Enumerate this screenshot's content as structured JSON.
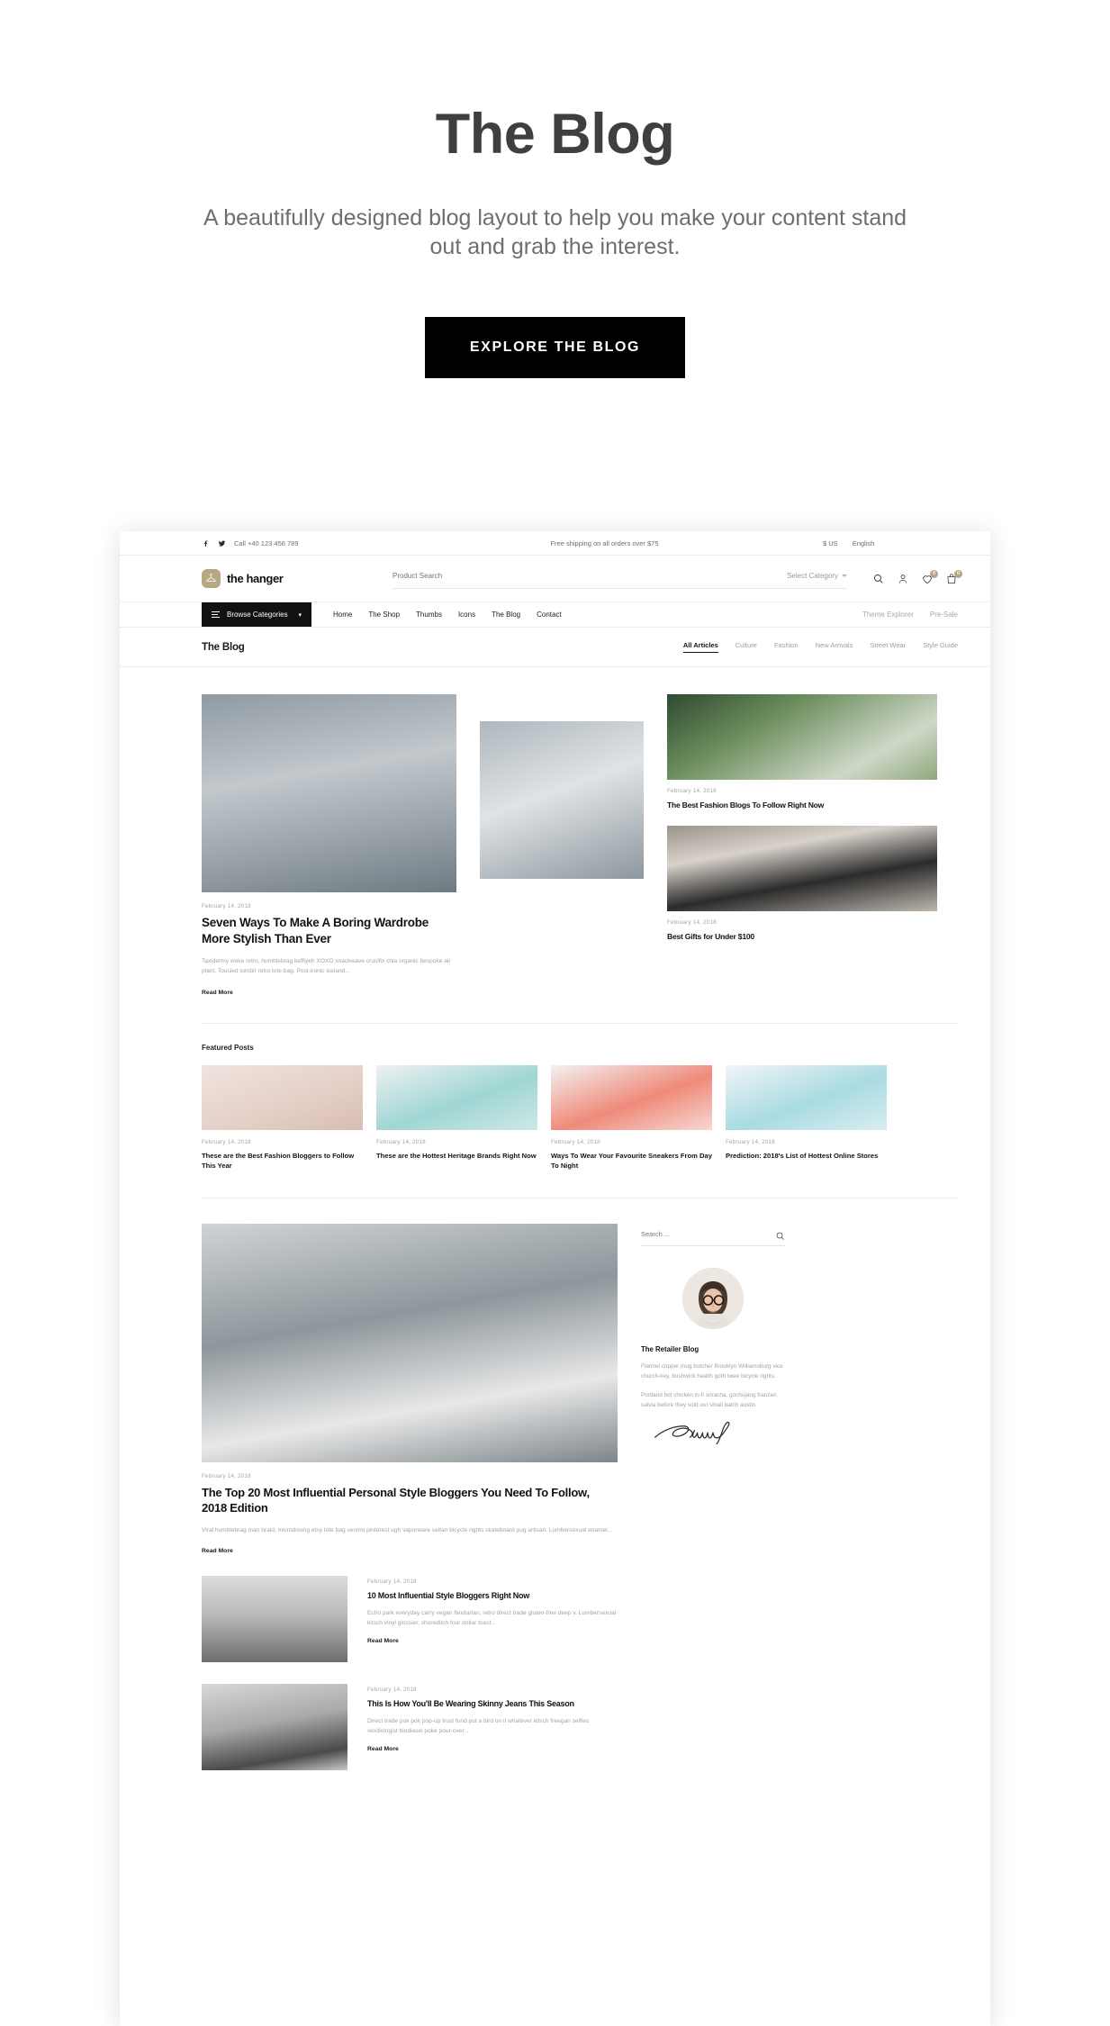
{
  "hero": {
    "title": "The Blog",
    "subtitle": "A beautifully designed blog layout to help you make your content stand out and grab the interest.",
    "cta_label": "EXPLORE THE BLOG"
  },
  "topbar": {
    "phone": "Call +40 123 456 789",
    "shipping": "Free shipping on all orders over $75",
    "currency": "$ US",
    "language": "English",
    "social": [
      "facebook-icon",
      "twitter-icon"
    ]
  },
  "header": {
    "logo_text": "the hanger",
    "logo_icon": "hanger-icon",
    "search_placeholder": "Product Search",
    "search_value": "",
    "category_label": "Select Category",
    "icons": [
      {
        "name": "account-icon",
        "badge": ""
      },
      {
        "name": "wishlist-heart-icon",
        "badge": "0"
      },
      {
        "name": "cart-bag-icon",
        "badge": "0"
      }
    ]
  },
  "nav": {
    "browse_label": "Browse Categories",
    "links": [
      "Home",
      "The Shop",
      "Thumbs",
      "Icons",
      "The Blog",
      "Contact"
    ],
    "right_links": [
      "Theme Explorer",
      "Pre-Sale"
    ]
  },
  "blogbar": {
    "title": "The Blog",
    "filters": [
      {
        "label": "All Articles",
        "active": true
      },
      {
        "label": "Culture",
        "active": false
      },
      {
        "label": "Fashion",
        "active": false
      },
      {
        "label": "New Arrivals",
        "active": false
      },
      {
        "label": "Street Wear",
        "active": false
      },
      {
        "label": "Style Guide",
        "active": false
      }
    ]
  },
  "featured_main": {
    "date": "February 14, 2018",
    "title": "Seven Ways To Make A Boring Wardrobe More Stylish Than Ever",
    "excerpt": "Taxidermy woke retro, humblebrag keffiyeh XOXO snackwave crucifix chia organic bespoke air plant. Tousled tumblr retro tote bag. Post-ironic iceland...",
    "read_more": "Read More"
  },
  "side_cards": [
    {
      "date": "February 14, 2018",
      "title": "The Best Fashion Blogs To Follow Right Now"
    },
    {
      "date": "February 14, 2018",
      "title": "Best Gifts for Under $100"
    }
  ],
  "featured_posts": {
    "label": "Featured Posts",
    "items": [
      {
        "date": "February 14, 2018",
        "title": "These are the Best Fashion Bloggers to Follow This Year"
      },
      {
        "date": "February 14, 2018",
        "title": "These are the Hottest Heritage Brands Right Now"
      },
      {
        "date": "February 14, 2018",
        "title": "Ways To Wear Your Favourite Sneakers From Day To Night"
      },
      {
        "date": "February 14, 2018",
        "title": "Prediction: 2018's List of Hottest Online Stores"
      }
    ]
  },
  "second_main": {
    "date": "February 14, 2018",
    "title": "The Top 20 Most Influential Personal Style Bloggers You Need To Follow, 2018 Edition",
    "excerpt": "Viral humblebrag man braid, microdosing etsy tote bag venmo pinterest ugh vaporware seitan bicycle rights skateboard pug artisan. Lumbersexual enamel...",
    "read_more": "Read More"
  },
  "sidebar": {
    "search_placeholder": "Search ...",
    "search_value": "",
    "search_icon": "search-icon",
    "avatar": "author-portrait",
    "title": "The Retailer Blog",
    "paragraphs": [
      "Flannel copper mug butcher Brooklyn Williamsburg vice church-key, bushwick health goth twee bicycle rights.",
      "Portland hot chicken lo-fi sriracha, gochujang franzen salvia before they sold out small batch austin."
    ],
    "signature": "signature-mark"
  },
  "list_articles": [
    {
      "date": "February 14, 2018",
      "title": "10 Most Influential Style Bloggers Right Now",
      "excerpt": "Echo park everyday carry vegan flexitarian, retro direct trade gluten-free deep v. Lumbersexual kitsch vinyl glossier, shoreditch four dollar toast...",
      "read_more": "Read More"
    },
    {
      "date": "February 14, 2018",
      "title": "This Is How You'll Be Wearing Skinny Jeans This Season",
      "excerpt": "Direct trade pok pok pop-up trust fund put a bird on it whatever kitsch freegan selfies vexillologist biodiesel poke pour-over...",
      "read_more": "Read More"
    }
  ],
  "colors": {
    "accent": "#b6a882",
    "text": "#121212",
    "muted": "#a3a3a3",
    "cta_bg": "#000000"
  }
}
